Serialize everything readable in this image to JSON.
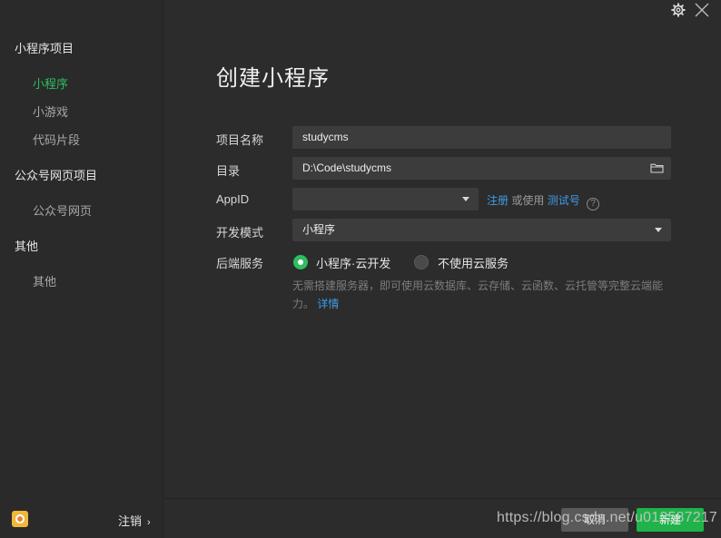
{
  "sidebar": {
    "groups": [
      {
        "title": "小程序项目",
        "items": [
          "小程序",
          "小游戏",
          "代码片段"
        ]
      },
      {
        "title": "公众号网页项目",
        "items": [
          "公众号网页"
        ]
      },
      {
        "title": "其他",
        "items": [
          "其他"
        ]
      }
    ],
    "active_item": "小程序",
    "logout_label": "注销",
    "logout_chevron": "›"
  },
  "header": {
    "title": "创建小程序"
  },
  "form": {
    "project_name": {
      "label": "项目名称",
      "value": "studycms"
    },
    "directory": {
      "label": "目录",
      "value": "D:\\Code\\studycms"
    },
    "appid": {
      "label": "AppID",
      "value": "",
      "register_link": "注册",
      "or_text": "或使用",
      "test_link": "测试号",
      "help": "?"
    },
    "dev_mode": {
      "label": "开发模式",
      "value": "小程序"
    },
    "backend": {
      "label": "后端服务",
      "option_cloud": "小程序·云开发",
      "option_none": "不使用云服务",
      "selected": "小程序·云开发",
      "description": "无需搭建服务器，即可使用云数据库、云存储、云函数、云托管等完整云端能力。",
      "details_link": "详情"
    }
  },
  "footer": {
    "cancel_label": "取消",
    "create_label": "新建",
    "watermark": "https://blog.csdn.net/u012587217"
  },
  "colors": {
    "accent_green": "#2dbe5f",
    "link_blue": "#3e9be8",
    "background": "#2c2c2c"
  },
  "icons": [
    "settings-gear-icon",
    "close-icon",
    "folder-icon",
    "chevron-down-icon",
    "help-icon",
    "user-avatar-icon"
  ]
}
